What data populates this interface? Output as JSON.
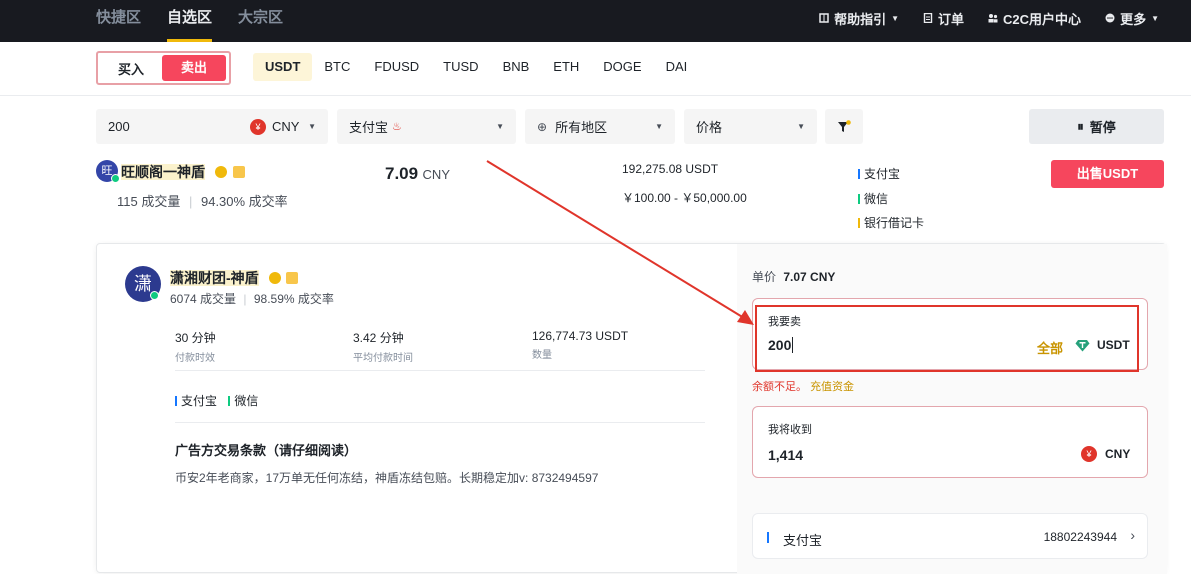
{
  "topbar": {
    "tabs": [
      {
        "label": "快捷区",
        "active": false
      },
      {
        "label": "自选区",
        "active": true
      },
      {
        "label": "大宗区",
        "active": false
      }
    ],
    "right_items": [
      {
        "label": "帮助指引",
        "icon": "book-icon",
        "has_caret": true
      },
      {
        "label": "订单",
        "icon": "document-icon",
        "has_caret": false
      },
      {
        "label": "C2C用户中心",
        "icon": "user-center-icon",
        "has_caret": false
      },
      {
        "label": "更多",
        "icon": "more-icon",
        "has_caret": true
      }
    ]
  },
  "trade_toggle": {
    "buy_label": "买入",
    "sell_label": "卖出",
    "selected": "sell"
  },
  "coins": [
    "USDT",
    "BTC",
    "FDUSD",
    "TUSD",
    "BNB",
    "ETH",
    "DOGE",
    "DAI"
  ],
  "coins_selected": "USDT",
  "filters": {
    "amount_value": "200",
    "currency": "CNY",
    "payment_method": "支付宝",
    "region": "所有地区",
    "sort": "价格",
    "pause_label": "暂停"
  },
  "listing": {
    "merchant_name": "旺顺阁一神盾",
    "avatar_char": "旺",
    "orders": "115 成交量",
    "completion": "94.30% 成交率",
    "price": "7.09",
    "price_unit": "CNY",
    "available": "192,275.08 USDT",
    "limit": "￥100.00 - ￥50,000.00",
    "payments": [
      {
        "label": "支付宝",
        "color": "#1677ff"
      },
      {
        "label": "微信",
        "color": "#0ecb81"
      },
      {
        "label": "银行借记卡",
        "color": "#f0b90b"
      }
    ],
    "action_label": "出售USDT"
  },
  "detail": {
    "merchant_name": "潇湘财团-神盾",
    "avatar_char": "潇",
    "orders": "6074 成交量",
    "completion": "98.59% 成交率",
    "stats": [
      {
        "value": "30 分钟",
        "label": "付款时效"
      },
      {
        "value": "3.42 分钟",
        "label": "平均付款时间"
      },
      {
        "value": "126,774.73 USDT",
        "label": "数量"
      }
    ],
    "payments": [
      {
        "label": "支付宝",
        "color": "#1677ff"
      },
      {
        "label": "微信",
        "color": "#0ecb81"
      }
    ],
    "terms_title": "广告方交易条款（请仔细阅读）",
    "terms_text": "币安2年老商家，17万单无任何冻结，神盾冻结包赔。长期稳定加v: 8732494597",
    "unit_price_label": "单价",
    "unit_price": "7.07 CNY",
    "sell_label": "我要卖",
    "sell_value": "200",
    "all_label": "全部",
    "sell_currency": "USDT",
    "error_text": "余额不足。",
    "topup_link": "充值资金",
    "receive_label": "我将收到",
    "receive_value": "1,414",
    "receive_currency": "CNY",
    "payment_account_method": "支付宝",
    "payment_account": "18802243944"
  },
  "colors": {
    "sell_red": "#f6465d",
    "accent_yellow": "#f0b90b",
    "annotation_red": "#e0352b"
  }
}
